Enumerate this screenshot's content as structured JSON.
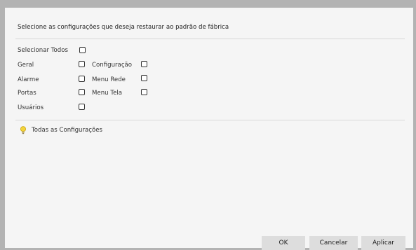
{
  "dialog": {
    "instruction": "Selecione as configurações que deseja restaurar ao padrão de fábrica"
  },
  "options": {
    "select_all": "Selecionar Todos",
    "geral": "Geral",
    "alarme": "Alarme",
    "portas": "Portas",
    "usuarios": "Usuários",
    "configuracao": "Configuração",
    "menu_rede": "Menu Rede",
    "menu_tela": "Menu Tela"
  },
  "hint": {
    "icon": "lightbulb-icon",
    "text": "Todas as Configurações",
    "icon_color": "#e8c22a"
  },
  "buttons": {
    "ok": "OK",
    "cancel": "Cancelar",
    "apply": "Aplicar"
  }
}
